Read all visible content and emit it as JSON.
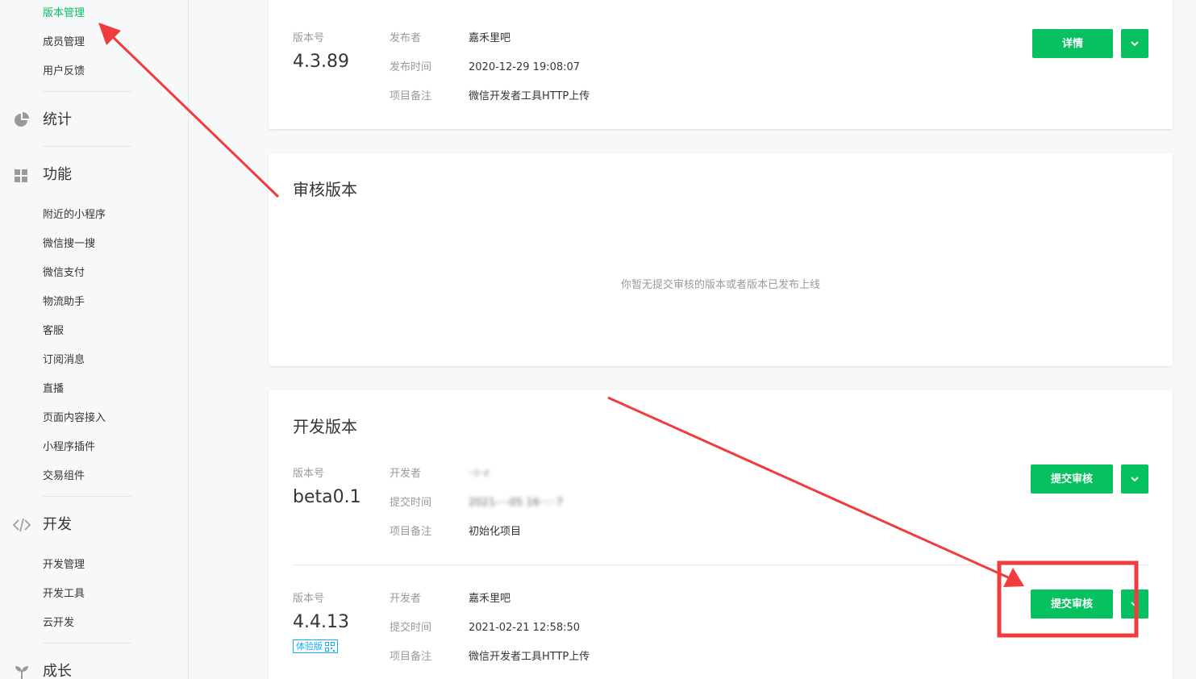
{
  "sidebar": {
    "top_items": [
      {
        "label": "版本管理",
        "active": true
      },
      {
        "label": "成员管理"
      },
      {
        "label": "用户反馈"
      }
    ],
    "groups": {
      "stats": {
        "label": "统计",
        "icon": "pie-chart-icon"
      },
      "features": {
        "label": "功能",
        "icon": "grid-icon"
      },
      "dev": {
        "label": "开发",
        "icon": "code-icon"
      },
      "growth": {
        "label": "成长",
        "icon": "sprout-icon"
      }
    },
    "feature_items": [
      "附近的小程序",
      "微信搜一搜",
      "微信支付",
      "物流助手",
      "客服",
      "订阅消息",
      "直播",
      "页面内容接入",
      "小程序插件",
      "交易组件"
    ],
    "dev_items": [
      "开发管理",
      "开发工具",
      "云开发"
    ]
  },
  "online_version": {
    "version_label": "版本号",
    "version": "4.3.89",
    "meta": [
      {
        "key": "发布者",
        "value": "嘉禾里吧"
      },
      {
        "key": "发布时间",
        "value": "2020-12-29 19:08:07"
      },
      {
        "key": "项目备注",
        "value": "微信开发者工具HTTP上传"
      }
    ],
    "button": "详情"
  },
  "review_version": {
    "title": "审核版本",
    "empty_message": "你暂无提交审核的版本或者版本已发布上线"
  },
  "dev_version": {
    "title": "开发版本",
    "entries": [
      {
        "version_label": "版本号",
        "version": "beta0.1",
        "meta": [
          {
            "key": "开发者",
            "value": "··i··r",
            "blurred": true
          },
          {
            "key": "提交时间",
            "value": "2021-··-05 16··:··7",
            "blurred": true
          },
          {
            "key": "项目备注",
            "value": "初始化项目"
          }
        ],
        "button": "提交审核"
      },
      {
        "version_label": "版本号",
        "version": "4.4.13",
        "badge": "体验版",
        "meta": [
          {
            "key": "开发者",
            "value": "嘉禾里吧"
          },
          {
            "key": "提交时间",
            "value": "2021-02-21 12:58:50"
          },
          {
            "key": "项目备注",
            "value": "微信开发者工具HTTP上传"
          }
        ],
        "button": "提交审核"
      }
    ]
  },
  "colors": {
    "accent": "#07c160",
    "annotation": "#f03c3c",
    "badge": "#10aeff"
  }
}
